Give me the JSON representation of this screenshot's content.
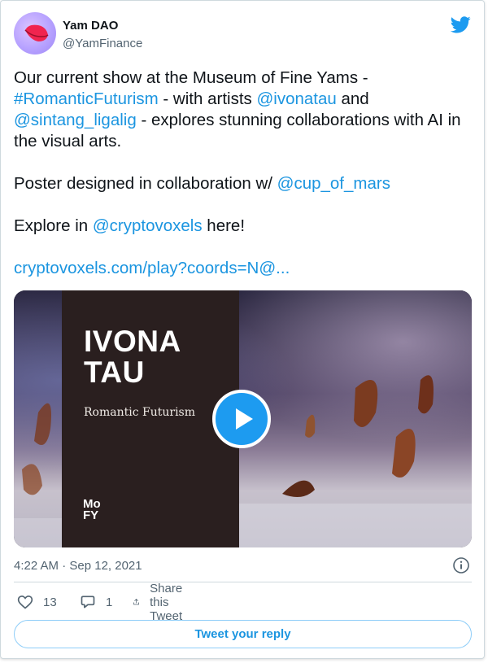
{
  "author": {
    "name": "Yam DAO",
    "handle": "@YamFinance"
  },
  "tweet": {
    "line1_pre": "Our current show at the Museum of Fine Yams -",
    "hashtag": "#RomanticFuturism",
    "line2_mid": " - with artists ",
    "mention1": "@ivonatau",
    "line2_and": " and",
    "mention2": "@sintang_ligalig",
    "line3_rest": " - explores stunning collaborations with AI in the visual arts.",
    "poster_pre": "Poster designed in collaboration w/ ",
    "mention3": "@cup_of_mars",
    "explore_pre": "Explore in ",
    "mention4": "@cryptovoxels",
    "explore_post": " here!",
    "url": "cryptovoxels.com/play?coords=N@..."
  },
  "media": {
    "title": "IVONA\nTAU",
    "subtitle": "Romantic Futurism",
    "logo": "Mo\nFY"
  },
  "timestamp": "4:22 AM · Sep 12, 2021",
  "stats": {
    "likes": "13",
    "replies": "1",
    "share_label": "Share this Tweet"
  },
  "reply_button": "Tweet your reply",
  "colors": {
    "accent": "#1d9bf0",
    "link": "#1b95e0",
    "text": "#0f1419",
    "muted": "#536471"
  },
  "icons": [
    "twitter-bird-icon",
    "play-icon",
    "info-icon",
    "heart-icon",
    "reply-icon",
    "share-icon"
  ]
}
